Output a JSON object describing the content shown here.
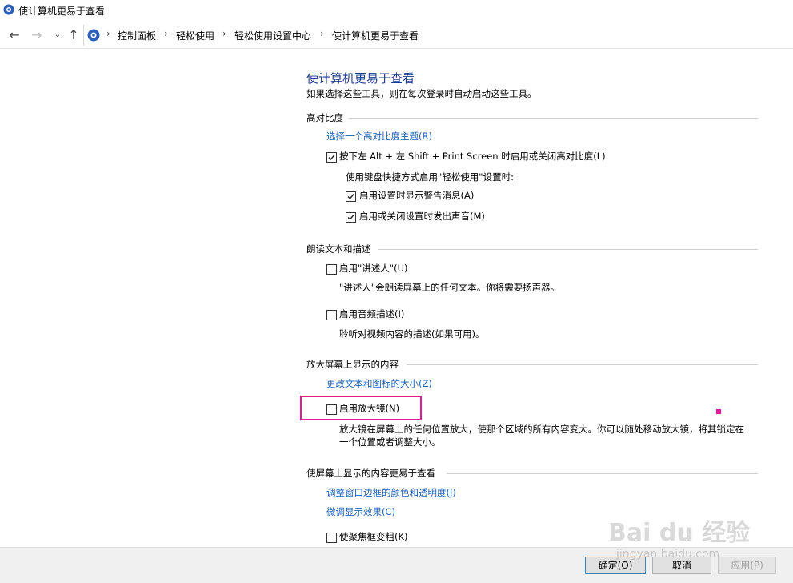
{
  "window": {
    "title": "使计算机更易于查看"
  },
  "nav": {
    "back_icon": "back-arrow-icon",
    "forward_icon": "forward-arrow-icon",
    "recent_icon": "chevron-down-icon",
    "up_icon": "up-arrow-icon",
    "breadcrumbs": [
      "控制面板",
      "轻松使用",
      "轻松使用设置中心",
      "使计算机更易于查看"
    ],
    "separator": "›"
  },
  "page": {
    "title": "使计算机更易于查看",
    "subtitle": "如果选择这些工具，则在每次登录时自动启动这些工具。"
  },
  "sections": {
    "high_contrast": {
      "heading": "高对比度",
      "link": "选择一个高对比度主题(R)",
      "shortcut_label": "按下左 Alt + 左 Shift + Print Screen 时启用或关闭高对比度(L)",
      "shortcut_checked": true,
      "note": "使用键盘快捷方式启用\"轻松使用\"设置时:",
      "warn_label": "启用设置时显示警告消息(A)",
      "warn_checked": true,
      "sound_label": "启用或关闭设置时发出声音(M)",
      "sound_checked": true
    },
    "narrate": {
      "heading": "朗读文本和描述",
      "narrator_label": "启用\"讲述人\"(U)",
      "narrator_checked": false,
      "narrator_desc": "\"讲述人\"会朗读屏幕上的任何文本。你将需要扬声器。",
      "audio_label": "启用音频描述(I)",
      "audio_checked": false,
      "audio_desc": "聆听对视频内容的描述(如果可用)。"
    },
    "magnify": {
      "heading": "放大屏幕上显示的内容",
      "link": "更改文本和图标的大小(Z)",
      "magnifier_label": "启用放大镜(N)",
      "magnifier_checked": false,
      "magnifier_desc_1": "放大镜在屏幕上的任何位置放大，使那个区域的所有内容变大。你可以随处移动放大镜，将其锁定在",
      "magnifier_desc_2": "一个位置或者调整大小。"
    },
    "easier": {
      "heading": "使屏幕上显示的内容更易于查看",
      "link1": "调整窗口边框的颜色和透明度(J)",
      "link2": "微调显示效果(C)",
      "focus_label": "使聚焦框变粗(K)",
      "focus_checked": false
    }
  },
  "footer": {
    "ok": "确定(O)",
    "cancel": "取消",
    "apply": "应用(P)"
  },
  "watermark": {
    "main": "Bai du 经验",
    "url": "jingyan.baidu.com"
  },
  "colors": {
    "link": "#1a5fb4",
    "title": "#1e3c8c",
    "highlight": "#e8179a"
  }
}
